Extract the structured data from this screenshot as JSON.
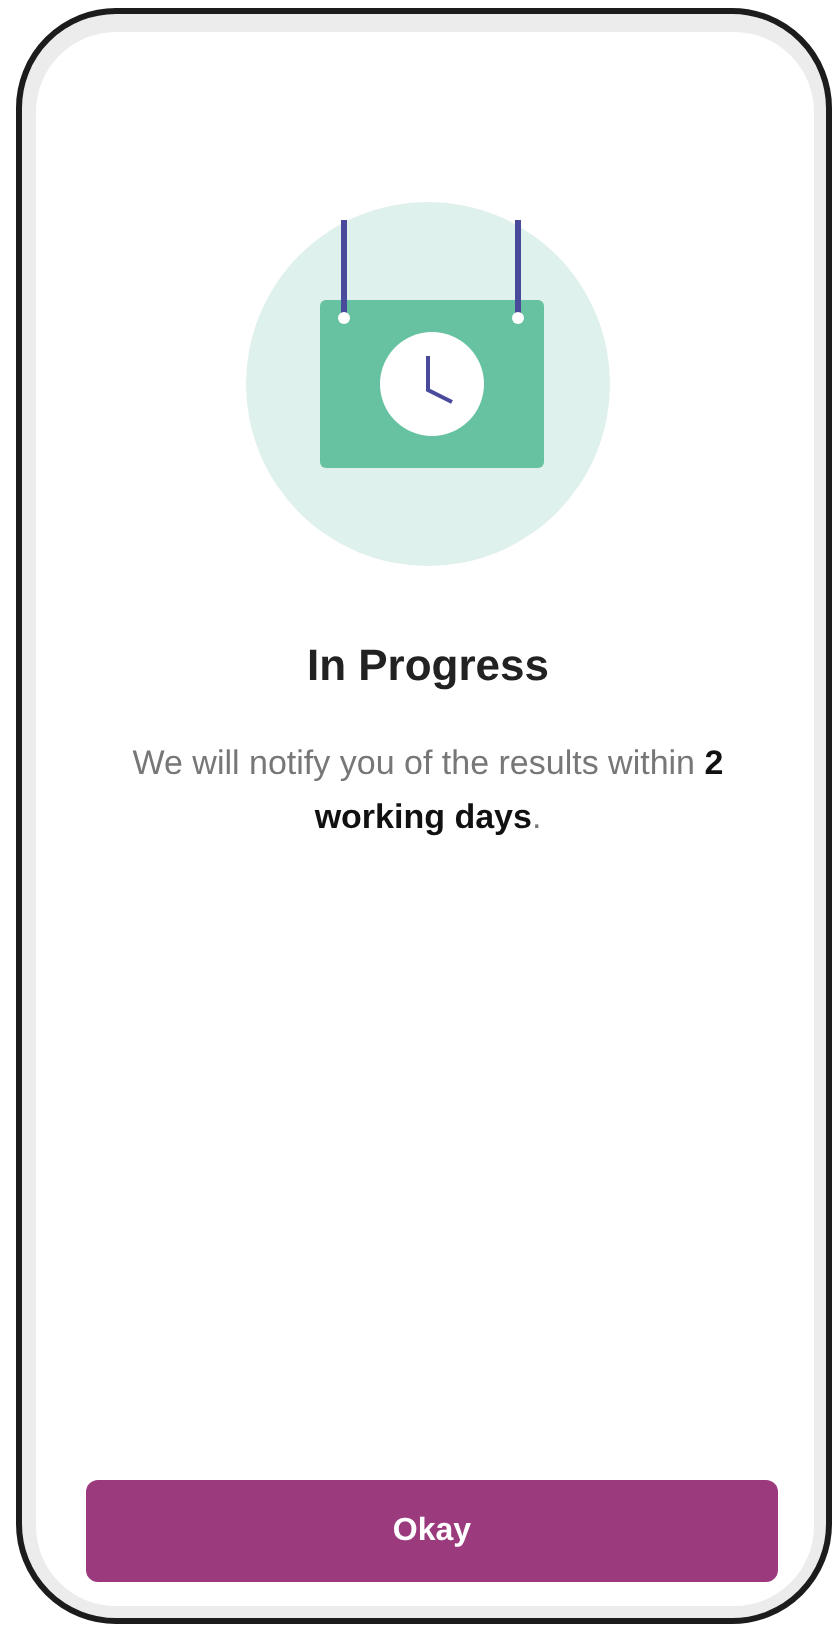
{
  "status": {
    "title": "In Progress",
    "message": "We will notify you of the results within **2 working days**."
  },
  "button": {
    "label": "Okay"
  }
}
